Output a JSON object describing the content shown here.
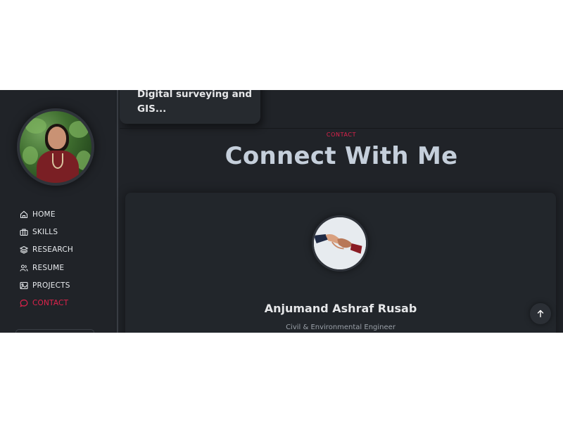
{
  "profile": {
    "avatar_alt": "profile photo"
  },
  "nav": {
    "items": [
      {
        "label": "HOME",
        "icon": "home-icon",
        "active": false
      },
      {
        "label": "SKILLS",
        "icon": "briefcase-icon",
        "active": false
      },
      {
        "label": "RESEARCH",
        "icon": "layers-icon",
        "active": false
      },
      {
        "label": "RESUME",
        "icon": "users-icon",
        "active": false
      },
      {
        "label": "PROJECTS",
        "icon": "image-icon",
        "active": false
      },
      {
        "label": "CONTACT",
        "icon": "chat-icon",
        "active": true
      }
    ]
  },
  "project_card": {
    "text": "Digital surveying and GIS..."
  },
  "contact_section": {
    "label": "CONTACT",
    "title": "Connect With Me",
    "name": "Anjumand Ashraf Rusab",
    "role": "Civil & Environmental Engineer"
  },
  "colors": {
    "accent": "#e0234c",
    "background": "#202328",
    "card": "#22262b",
    "title": "#c5cfdb"
  },
  "icons": {
    "scroll_top": "arrow-up-icon",
    "contact_image": "handshake-icon"
  }
}
